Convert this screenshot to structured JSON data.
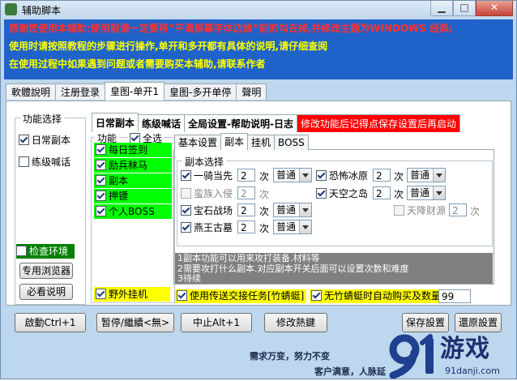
{
  "window": {
    "title": "辅助脚本",
    "min_glyph": "▁",
    "max_glyph": "□",
    "close_glyph": "✕"
  },
  "notice": [
    "感谢您使用本辅助:使用前请一定要将”平滑屏幕字体边缘”前的勾去掉,并修改主题为WINDOWS 经典;",
    "使用时请按照教程的步骤进行操作,单开和多开都有具体的说明,请仔细查阅",
    "在使用过程中如果遇到问题或者需要购买本辅助,请联系作者"
  ],
  "main_tabs": [
    "軟體說明",
    "注册登录",
    "皇图-单开1",
    "皇图-多开单停",
    "聲明"
  ],
  "func_select": {
    "title": "功能选择",
    "items": [
      {
        "label": "日常副本",
        "checked": true
      },
      {
        "label": "练级喊话",
        "checked": false
      }
    ],
    "check_env": "检查环境",
    "browser_btn": "专用浏览器",
    "must_read_btn": "必看说明"
  },
  "sub_tabs": [
    "日常副本",
    "练级喊话",
    "全局设置-帮助说明-日志",
    "修改功能后记得点保存设置后再启动"
  ],
  "func_list": {
    "title": "功能",
    "select_all": "全选",
    "items": [
      "每日签到",
      "励兵秣马",
      "副本",
      "押镖",
      "个人BOSS"
    ],
    "wild_hang": "野外挂机"
  },
  "inner_tabs": [
    "基本设置",
    "副本",
    "挂机",
    "BOSS"
  ],
  "dungeon": {
    "title": "副本选择",
    "unit": "次",
    "rows": [
      {
        "name": "一骑当先",
        "checked": true,
        "count": "2",
        "mode": "普通",
        "enabled": true
      },
      {
        "name": "蛮族入侵",
        "checked": false,
        "count": "2",
        "mode": "",
        "enabled": false
      },
      {
        "name": "宝石战场",
        "checked": true,
        "count": "2",
        "mode": "普通",
        "enabled": true
      },
      {
        "name": "燕王古墓",
        "checked": true,
        "count": "2",
        "mode": "普通",
        "enabled": true
      },
      {
        "name": "恐怖冰原",
        "checked": true,
        "count": "2",
        "mode": "普通",
        "enabled": true
      },
      {
        "name": "天空之岛",
        "checked": true,
        "count": "2",
        "mode": "普通",
        "enabled": true
      },
      {
        "name": "天降财源",
        "checked": false,
        "count": "2",
        "mode": "",
        "enabled": false
      }
    ]
  },
  "info_lines": [
    "1副本功能可以用来攻打装备.材料等",
    "2需要攻打什么副本.对应副本开关后面可以设置次数和难度",
    "3待续"
  ],
  "transfer_task": "使用传送交接任务[竹蜻蜓]",
  "auto_buy": "无竹蜻蜓时自动购买及数量",
  "auto_buy_qty": "99",
  "bottom_buttons": {
    "start": "啟動Ctrl+1",
    "pause": "暂停/繼續<無>",
    "stop": "中止Alt+1",
    "hotkey": "修改熱鍵",
    "save": "保存設置",
    "restore": "還原設置"
  },
  "footer": [
    "需求万变，努力不变",
    "客户满意，人脉延"
  ],
  "logo": {
    "main": "游戏",
    "sub": "91danji.com"
  }
}
